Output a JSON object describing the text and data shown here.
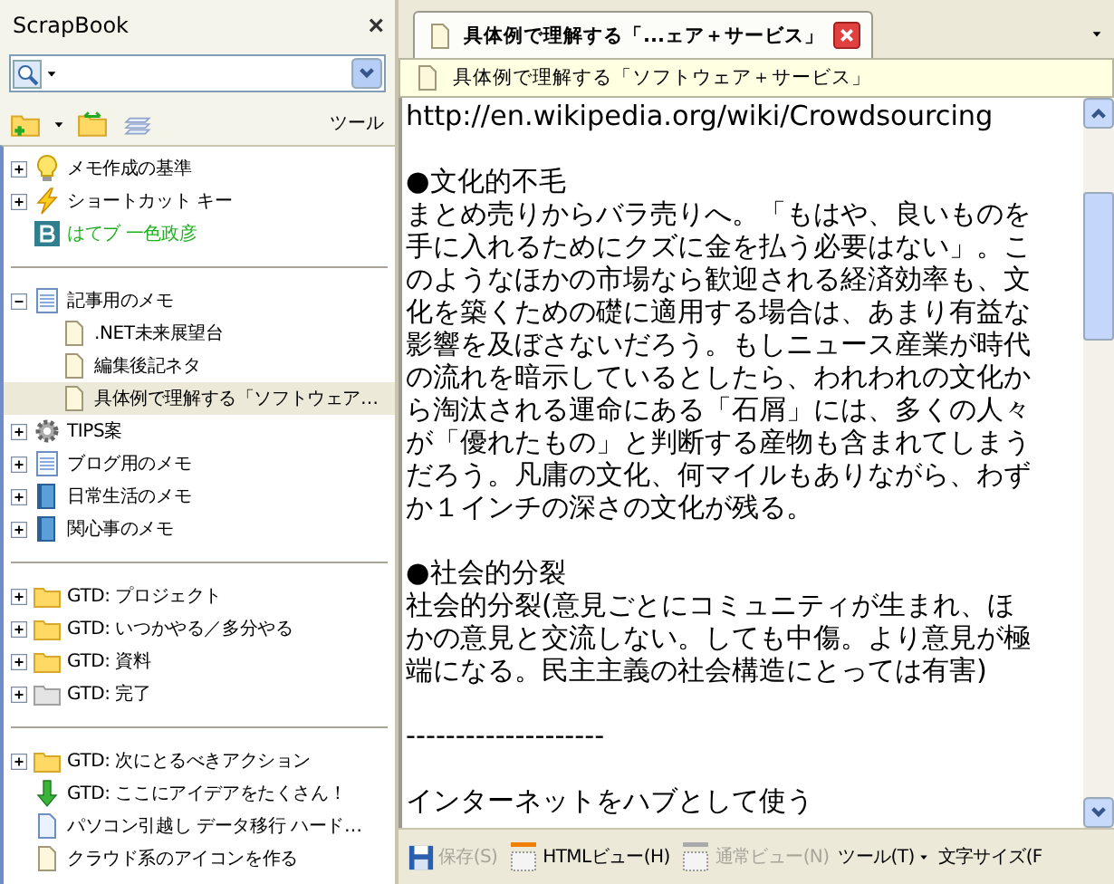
{
  "sidebar": {
    "title": "ScrapBook",
    "close_label": "×",
    "toolbar": {
      "tools_label": "ツール"
    },
    "groups": [
      {
        "items": [
          {
            "label": "メモ作成の基準",
            "kind": "bulb",
            "expanded": false,
            "selected": false
          },
          {
            "label": "ショートカット キー",
            "kind": "bolt",
            "expanded": false,
            "selected": false
          },
          {
            "label": "はてブ 一色政彦",
            "kind": "bookmark",
            "color": "#22b022",
            "selected": false
          }
        ]
      },
      {
        "items": [
          {
            "label": "記事用のメモ",
            "kind": "notepad",
            "expanded": true,
            "selected": false,
            "children": [
              {
                "label": ".NET未来展望台",
                "kind": "page",
                "selected": false
              },
              {
                "label": "編集後記ネタ",
                "kind": "page",
                "selected": false
              },
              {
                "label": "具体例で理解する「ソフトウェア…",
                "kind": "page",
                "selected": true
              }
            ]
          },
          {
            "label": "TIPS案",
            "kind": "gear",
            "expanded": false,
            "selected": false
          },
          {
            "label": "ブログ用のメモ",
            "kind": "notepad",
            "expanded": false,
            "selected": false
          },
          {
            "label": "日常生活のメモ",
            "kind": "book",
            "expanded": false,
            "selected": false
          },
          {
            "label": "関心事のメモ",
            "kind": "book",
            "expanded": false,
            "selected": false
          }
        ]
      },
      {
        "items": [
          {
            "label": "GTD: プロジェクト",
            "kind": "folder",
            "expanded": false,
            "selected": false
          },
          {
            "label": "GTD: いつかやる／多分やる",
            "kind": "folder",
            "expanded": false,
            "selected": false
          },
          {
            "label": "GTD: 資料",
            "kind": "folder",
            "expanded": false,
            "selected": false
          },
          {
            "label": "GTD: 完了",
            "kind": "folder-gray",
            "expanded": false,
            "selected": false
          }
        ]
      },
      {
        "items": [
          {
            "label": "GTD: 次にとるべきアクション",
            "kind": "folder",
            "expanded": false,
            "selected": false
          },
          {
            "label": "GTD: ここにアイデアをたくさん！",
            "kind": "arrow",
            "selected": false
          },
          {
            "label": "パソコン引越し データ移行 ハード…",
            "kind": "doc",
            "selected": false
          },
          {
            "label": "クラウド系のアイコンを作る",
            "kind": "page",
            "selected": false
          }
        ]
      }
    ]
  },
  "tabs": [
    {
      "label": "具体例で理解する「...ェア＋サービス」",
      "selected": true
    }
  ],
  "info_bar": {
    "text": "具体例で理解する「ソフトウェア＋サービス」"
  },
  "editor": {
    "paragraphs": [
      [
        "http://en.wikipedia.org/wiki/Crowdsourcing"
      ],
      [
        "●文化的不毛",
        "まとめ売りからバラ売りへ。「もはや、良いものを",
        "手に入れるためにクズに金を払う必要はない」。こ",
        "のようなほかの市場なら歓迎される経済効率も、文",
        "化を築くための礎に適用する場合は、あまり有益な",
        "影響を及ぼさないだろう。もしニュース産業が時代",
        "の流れを暗示しているとしたら、われわれの文化か",
        "ら淘汰される運命にある「石屑」には、多くの人々",
        "が「優れたもの」と判断する産物も含まれてしまう",
        "だろう。凡庸の文化、何マイルもありながら、わず",
        "か１インチの深さの文化が残る。"
      ],
      [
        "●社会的分裂",
        "社会的分裂(意見ごとにコミュニティが生まれ、ほ",
        "かの意見と交流しない。しても中傷。より意見が極",
        "端になる。民主主義の社会構造にとっては有害)"
      ],
      [
        "--------------------"
      ],
      [
        "インターネットをハブとして使う"
      ]
    ]
  },
  "bottom_toolbar": [
    {
      "label": "保存(S)",
      "kind": "save",
      "disabled": true
    },
    {
      "label": "HTMLビュー(H)",
      "kind": "html",
      "disabled": false
    },
    {
      "label": "通常ビュー(N)",
      "kind": "html",
      "disabled": true
    },
    {
      "label": "ツール(T)",
      "kind": "menu",
      "disabled": false
    },
    {
      "label": "文字サイズ(F",
      "kind": "text",
      "disabled": false
    }
  ]
}
